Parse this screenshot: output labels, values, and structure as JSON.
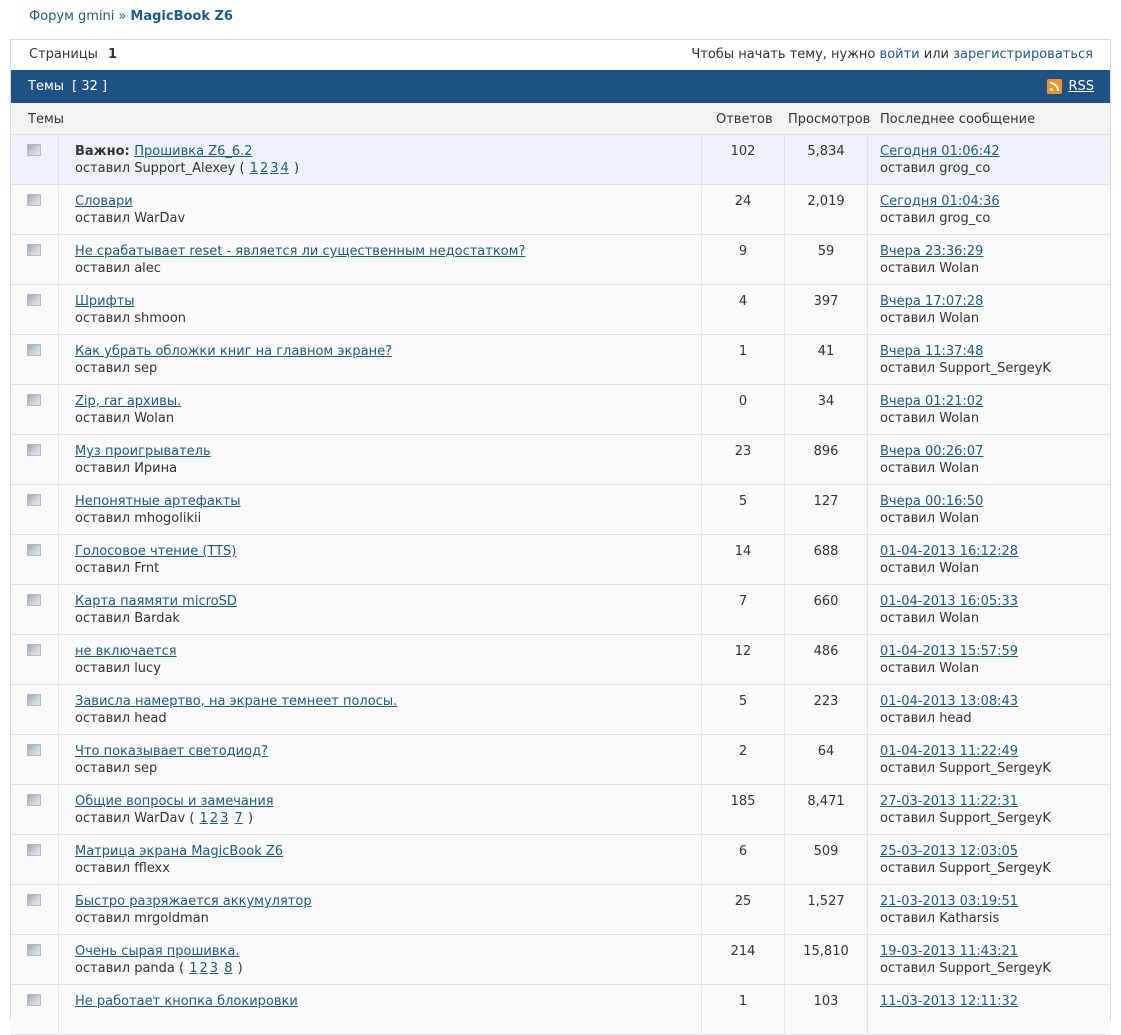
{
  "breadcrumb": {
    "forum": "Форум gmini",
    "sep": "»",
    "current": "MagicBook Z6"
  },
  "pagination": {
    "label": "Страницы",
    "current": "1"
  },
  "auth_prompt": {
    "text": "Чтобы начать тему, нужно",
    "login": "войти",
    "or": "или",
    "register": "зарегистрироваться"
  },
  "topics_bar": {
    "label": "Темы",
    "count": "[ 32 ]",
    "rss": "RSS"
  },
  "columns": {
    "topics": "Темы",
    "replies": "Ответов",
    "views": "Просмотров",
    "last": "Последнее сообщение"
  },
  "author_prefix": "оставил",
  "important_label": "Важно:",
  "rows": [
    {
      "title": "Прошивка Z6_6.2",
      "author": "Support_Alexey",
      "pages": [
        "1",
        "2",
        "3",
        "4"
      ],
      "replies": "102",
      "views": "5,834",
      "last_date": "Сегодня 01:06:42",
      "last_author": "grog_co",
      "sticky": true
    },
    {
      "title": "Словари",
      "author": "WarDav",
      "replies": "24",
      "views": "2,019",
      "last_date": "Сегодня 01:04:36",
      "last_author": "grog_co"
    },
    {
      "title": "Не срабатывает reset - является ли существенным недостатком?",
      "author": "alec",
      "replies": "9",
      "views": "59",
      "last_date": "Вчера 23:36:29",
      "last_author": "Wolan"
    },
    {
      "title": "Шрифты",
      "author": "shmoon",
      "replies": "4",
      "views": "397",
      "last_date": "Вчера 17:07:28",
      "last_author": "Wolan"
    },
    {
      "title": "Как убрать обложки книг на главном экране?",
      "author": "sep",
      "replies": "1",
      "views": "41",
      "last_date": "Вчера 11:37:48",
      "last_author": "Support_SergeyK"
    },
    {
      "title": "Zip, rar архивы.",
      "author": "Wolan",
      "replies": "0",
      "views": "34",
      "last_date": "Вчера 01:21:02",
      "last_author": "Wolan"
    },
    {
      "title": "Муз проигрыватель",
      "author": "Ирина",
      "replies": "23",
      "views": "896",
      "last_date": "Вчера 00:26:07",
      "last_author": "Wolan"
    },
    {
      "title": "Непонятные артефакты",
      "author": "mhogolikii",
      "replies": "5",
      "views": "127",
      "last_date": "Вчера 00:16:50",
      "last_author": "Wolan"
    },
    {
      "title": "Голосовое чтение (TTS)",
      "author": "Frnt",
      "replies": "14",
      "views": "688",
      "last_date": "01-04-2013 16:12:28",
      "last_author": "Wolan"
    },
    {
      "title": "Карта паямяти microSD",
      "author": "Bardak",
      "replies": "7",
      "views": "660",
      "last_date": "01-04-2013 16:05:33",
      "last_author": "Wolan"
    },
    {
      "title": "не включается",
      "author": "lucy",
      "replies": "12",
      "views": "486",
      "last_date": "01-04-2013 15:57:59",
      "last_author": "Wolan"
    },
    {
      "title": "Зависла намертво, на экране темнеет полосы.",
      "author": "head",
      "replies": "5",
      "views": "223",
      "last_date": "01-04-2013 13:08:43",
      "last_author": "head"
    },
    {
      "title": "Что показывает светодиод?",
      "author": "sep",
      "replies": "2",
      "views": "64",
      "last_date": "01-04-2013 11:22:49",
      "last_author": "Support_SergeyK"
    },
    {
      "title": "Общие вопросы и замечания",
      "author": "WarDav",
      "pages": [
        "1",
        "2",
        "3",
        "7"
      ],
      "replies": "185",
      "views": "8,471",
      "last_date": "27-03-2013 11:22:31",
      "last_author": "Support_SergeyK"
    },
    {
      "title": "Матрица экрана MagicBook Z6",
      "author": "fflexx",
      "replies": "6",
      "views": "509",
      "last_date": "25-03-2013 12:03:05",
      "last_author": "Support_SergeyK"
    },
    {
      "title": "Быстро разряжается аккумулятор",
      "author": "mrgoldman",
      "replies": "25",
      "views": "1,527",
      "last_date": "21-03-2013 03:19:51",
      "last_author": "Katharsis"
    },
    {
      "title": "Очень сырая прошивка.",
      "author": "panda",
      "pages": [
        "1",
        "2",
        "3",
        "8"
      ],
      "replies": "214",
      "views": "15,810",
      "last_date": "19-03-2013 11:43:21",
      "last_author": "Support_SergeyK"
    },
    {
      "title": "Не работает кнопка блокировки",
      "author": "",
      "replies": "1",
      "views": "103",
      "last_date": "11-03-2013 12:11:32",
      "last_author": ""
    }
  ]
}
